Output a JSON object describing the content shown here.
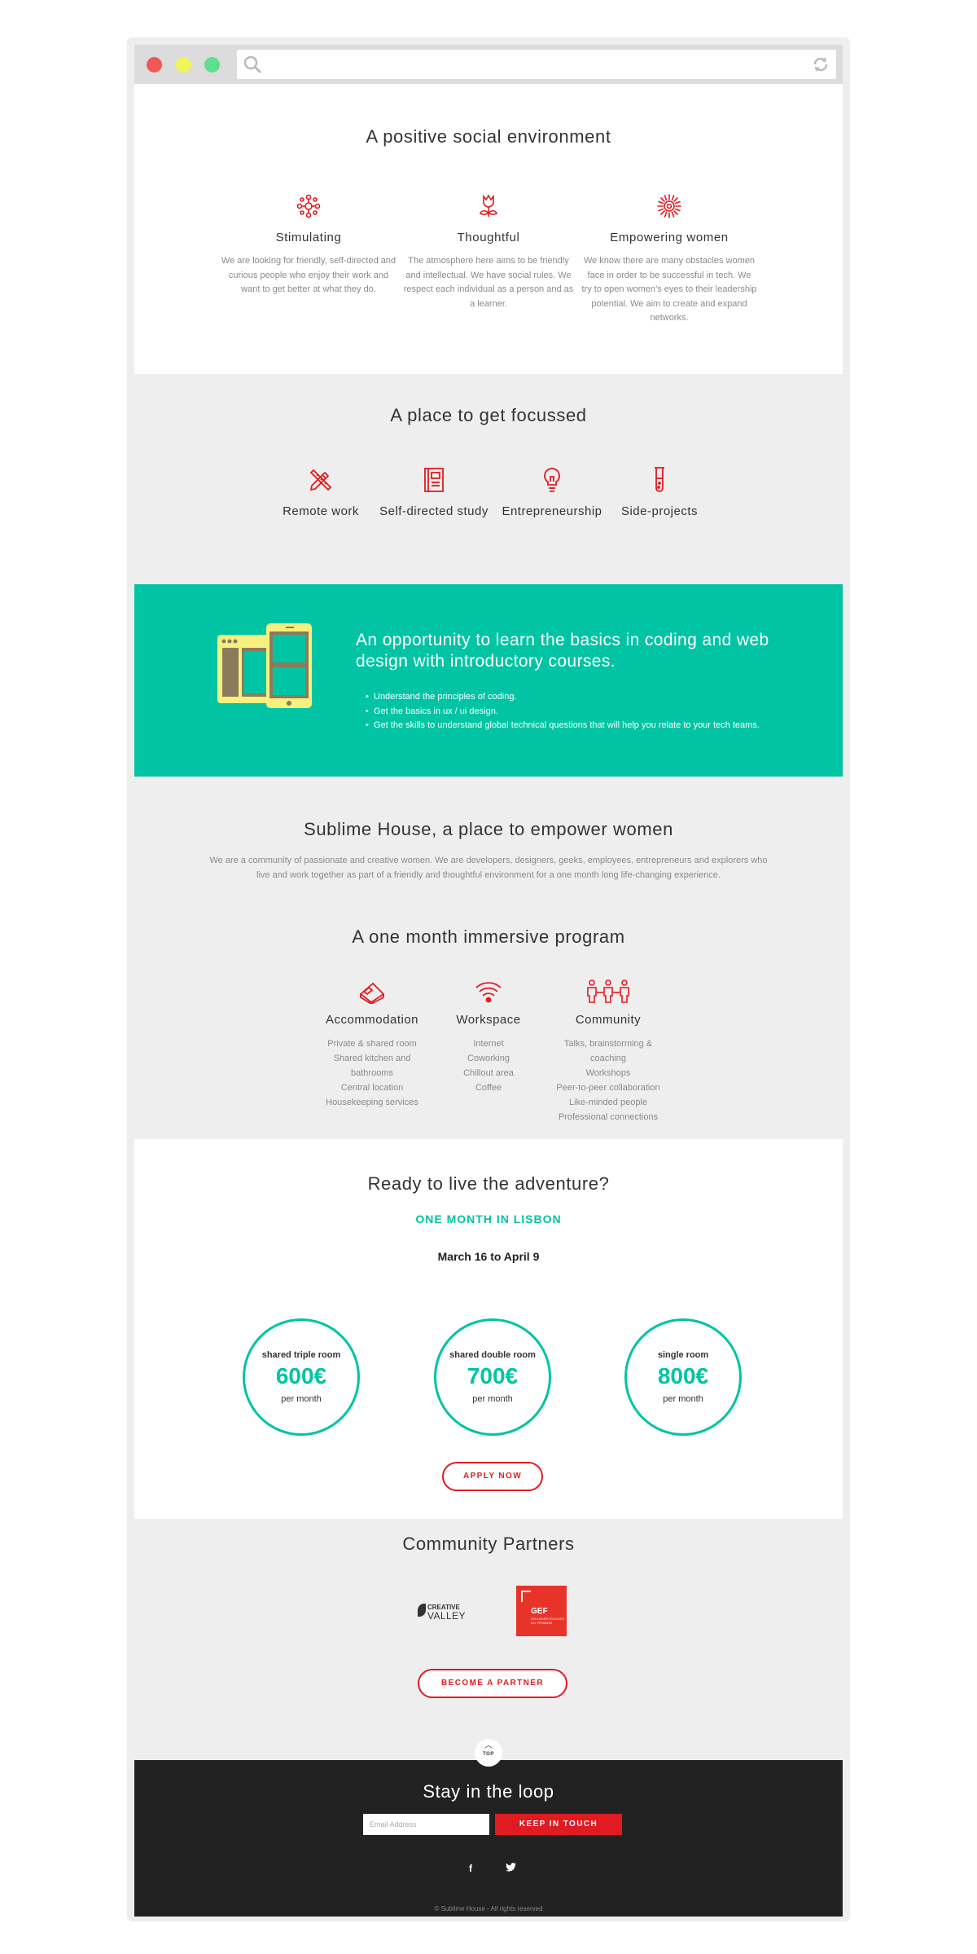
{
  "browser": {
    "url": ""
  },
  "social": {
    "title": "A positive social environment",
    "items": [
      {
        "icon": "flower-network-icon",
        "title": "Stimulating",
        "text": "We are looking for friendly, self-directed and curious people who enjoy their work and want to get better at what they do."
      },
      {
        "icon": "rose-icon",
        "title": "Thoughtful",
        "text": "The atmosphere here aims to be friendly and intellectual. We have social rules. We respect each individual as a person and as a learner."
      },
      {
        "icon": "sunburst-icon",
        "title": "Empowering women",
        "text": "We know there are many obstacles women face in order to be successful in tech. We try to open women’s eyes to their leadership potential. We aim to create and expand networks."
      }
    ]
  },
  "focus": {
    "title": "A place to get focussed",
    "items": [
      {
        "icon": "pencil-ruler-icon",
        "label": "Remote work"
      },
      {
        "icon": "notebook-icon",
        "label": "Self-directed study"
      },
      {
        "icon": "lightbulb-icon",
        "label": "Entrepreneurship"
      },
      {
        "icon": "test-tube-icon",
        "label": "Side-projects"
      }
    ]
  },
  "coding": {
    "title": "An opportunity to learn the basics in coding and web design with introductory courses.",
    "bullets": [
      "Understand the principles of coding.",
      "Get the basics in ux / ui design.",
      "Get the skills to understand global technical questions that will help you relate to your tech teams."
    ]
  },
  "sublime": {
    "title": "Sublime House, a place to empower women",
    "description": "We are a community of passionate and creative women. We are developers, designers, geeks, employees, entrepreneurs and explorers who live and work together as part of a friendly and thoughtful environment for a one month long life-changing experience.",
    "program_title": "A one month immersive program",
    "columns": [
      {
        "icon": "bed-icon",
        "title": "Accommodation",
        "items": [
          "Private & shared room",
          "Shared kitchen and bathrooms",
          "Central location",
          "Housekeeping services"
        ]
      },
      {
        "icon": "wifi-icon",
        "title": "Workspace",
        "items": [
          "Internet",
          "Coworking",
          "Chillout area",
          "Coffee"
        ]
      },
      {
        "icon": "people-icon",
        "title": "Community",
        "items": [
          "Talks, brainstorming & coaching",
          "Workshops",
          "Peer-to-peer collaboration",
          "Like-minded people",
          "Professional connections"
        ]
      }
    ]
  },
  "ready": {
    "title": "Ready to live the adventure?",
    "location": "ONE MONTH IN LISBON",
    "dates": "March 16 to April 9",
    "prices": [
      {
        "room": "shared triple room",
        "price": "600€",
        "per": "per month"
      },
      {
        "room": "shared double room",
        "price": "700€",
        "per": "per month"
      },
      {
        "room": "single room",
        "price": "800€",
        "per": "per month"
      }
    ],
    "apply_label": "APPLY NOW"
  },
  "partners": {
    "title": "Community Partners",
    "creative_valley": {
      "line1": "CREATIVE",
      "line2": "VALLEY"
    },
    "gef": {
      "acronym": "GEF",
      "sub": "GRANDES ÉCOLES AU FÉMININ"
    },
    "button_label": "BECOME A PARTNER"
  },
  "footer": {
    "top_label": "TOP",
    "title": "Stay in the loop",
    "email_placeholder": "Email Address",
    "keep_label": "KEEP IN TOUCH",
    "facebook_glyph": "f",
    "twitter_glyph": "🐦",
    "copyright": "© Sublime House - All rights reserved"
  },
  "colors": {
    "accent_red": "#e01b22",
    "teal": "#00c4a3",
    "device_yellow": "#f6f07e",
    "footer_bg": "#222222"
  }
}
